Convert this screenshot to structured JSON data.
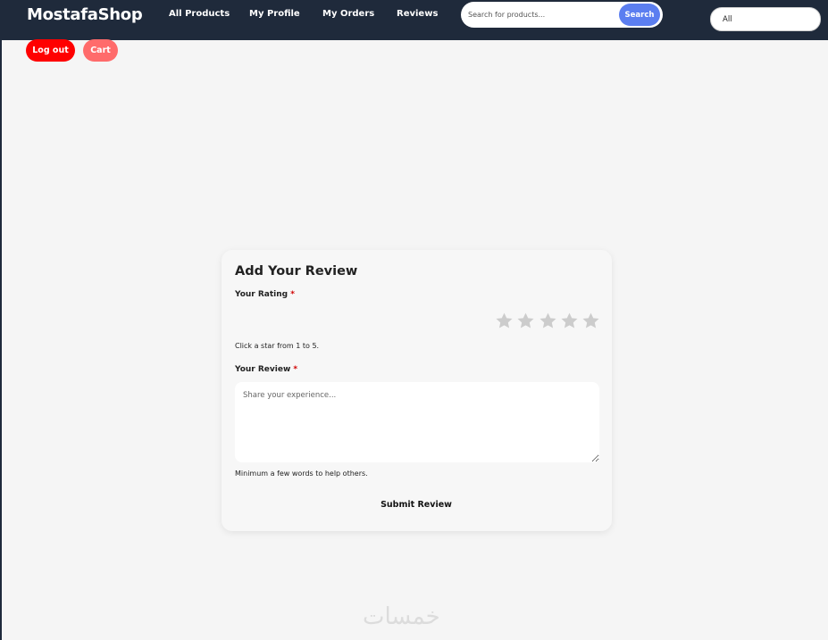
{
  "header": {
    "brand": "MostafaShop",
    "nav": [
      {
        "label": "All Products"
      },
      {
        "label": "My Profile"
      },
      {
        "label": "My Orders"
      },
      {
        "label": "Reviews"
      }
    ],
    "search": {
      "placeholder": "Search for products...",
      "value": "",
      "button_label": "Search"
    },
    "category_filter": {
      "selected": "All"
    }
  },
  "actions": {
    "logout_label": "Log out",
    "cart_label": "Cart"
  },
  "review_form": {
    "title": "Add Your Review",
    "rating_label": "Your Rating",
    "required_marker": "*",
    "rating": {
      "max": 5,
      "selected": 0,
      "icon": "star-icon",
      "empty_color": "#cccccc"
    },
    "rating_hint": "Click a star from 1 to 5.",
    "review_label": "Your Review",
    "review_placeholder": "Share your experience...",
    "review_value": "",
    "review_hint": "Minimum a few words to help others.",
    "submit_label": "Submit Review"
  },
  "watermark": "خمسات",
  "colors": {
    "navbar": "#1f2a3b",
    "search_button": "#5b7ef0",
    "logout_button": "#ff0000",
    "cart_button": "#ff6b6b",
    "required": "#d00000",
    "page_background": "#f5f5f5"
  }
}
